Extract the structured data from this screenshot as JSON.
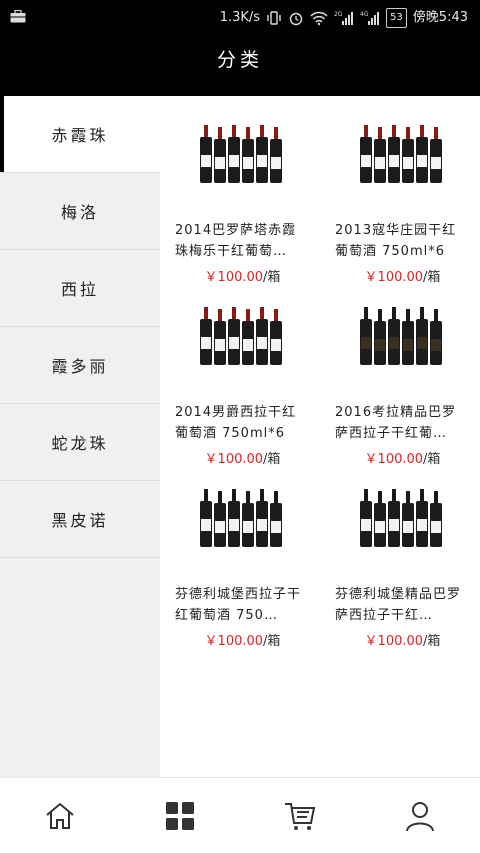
{
  "status_bar": {
    "speed": "1.3K/s",
    "battery": "53",
    "time": "傍晚5:43"
  },
  "header": {
    "title": "分类"
  },
  "sidebar": {
    "items": [
      {
        "label": "赤霞珠",
        "active": true
      },
      {
        "label": "梅洛",
        "active": false
      },
      {
        "label": "西拉",
        "active": false
      },
      {
        "label": "霞多丽",
        "active": false
      },
      {
        "label": "蛇龙珠",
        "active": false
      },
      {
        "label": "黑皮诺",
        "active": false
      }
    ]
  },
  "products": [
    {
      "name": "2014巴罗萨塔赤霞珠梅乐干红葡萄…",
      "price": "￥100.00",
      "unit": "/箱",
      "image": "wine-case-red-caps"
    },
    {
      "name": "2013寇华庄园干红葡萄酒 750ml*6",
      "price": "￥100.00",
      "unit": "/箱",
      "image": "wine-case-red-caps"
    },
    {
      "name": "2014男爵西拉干红葡萄酒 750ml*6",
      "price": "￥100.00",
      "unit": "/箱",
      "image": "wine-case-red-caps"
    },
    {
      "name": "2016考拉精品巴罗萨西拉子干红葡…",
      "price": "￥100.00",
      "unit": "/箱",
      "image": "wine-case-dark-labels"
    },
    {
      "name": "芬德利城堡西拉子干红葡萄酒 750…",
      "price": "￥100.00",
      "unit": "/箱",
      "image": "wine-case-black-caps"
    },
    {
      "name": "芬德利城堡精品巴罗萨西拉子干红…",
      "price": "￥100.00",
      "unit": "/箱",
      "image": "wine-case-black-caps"
    }
  ],
  "tab_bar": {
    "tabs": [
      {
        "icon": "home-icon",
        "active": false
      },
      {
        "icon": "category-grid-icon",
        "active": true
      },
      {
        "icon": "cart-icon",
        "active": false
      },
      {
        "icon": "user-icon",
        "active": false
      }
    ]
  },
  "colors": {
    "price": "#e02222",
    "header_bg": "#000000",
    "sidebar_bg": "#f0f0f0"
  }
}
